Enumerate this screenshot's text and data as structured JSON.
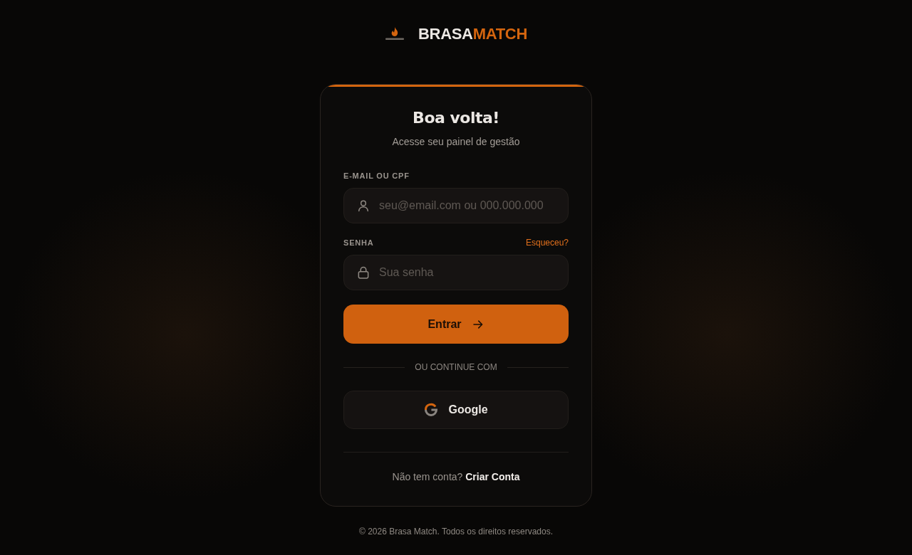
{
  "brand": {
    "words": [
      {
        "text": "BRASA",
        "color": "#ebe7e3"
      },
      {
        "text": "MATCH",
        "color": "#d4650f"
      }
    ]
  },
  "card": {
    "title": "Boa volta!",
    "subtitle": "Acesse seu painel de gestão",
    "fields": [
      {
        "kind": "text",
        "label": "E-MAIL OU CPF",
        "placeholder": "seu@email.com ou 000.000.000"
      },
      {
        "kind": "password",
        "label": "SENHA",
        "link": "Esqueceu?",
        "placeholder": "Sua senha"
      }
    ],
    "submit": "Entrar",
    "divider": "OU CONTINUE COM",
    "social": [
      {
        "kind": "google",
        "label": "Google"
      }
    ],
    "signup": {
      "prompt": "Não tem conta?",
      "link": "Criar Conta"
    }
  },
  "footer": "© 2026 Brasa Match. Todos os direitos reservados."
}
